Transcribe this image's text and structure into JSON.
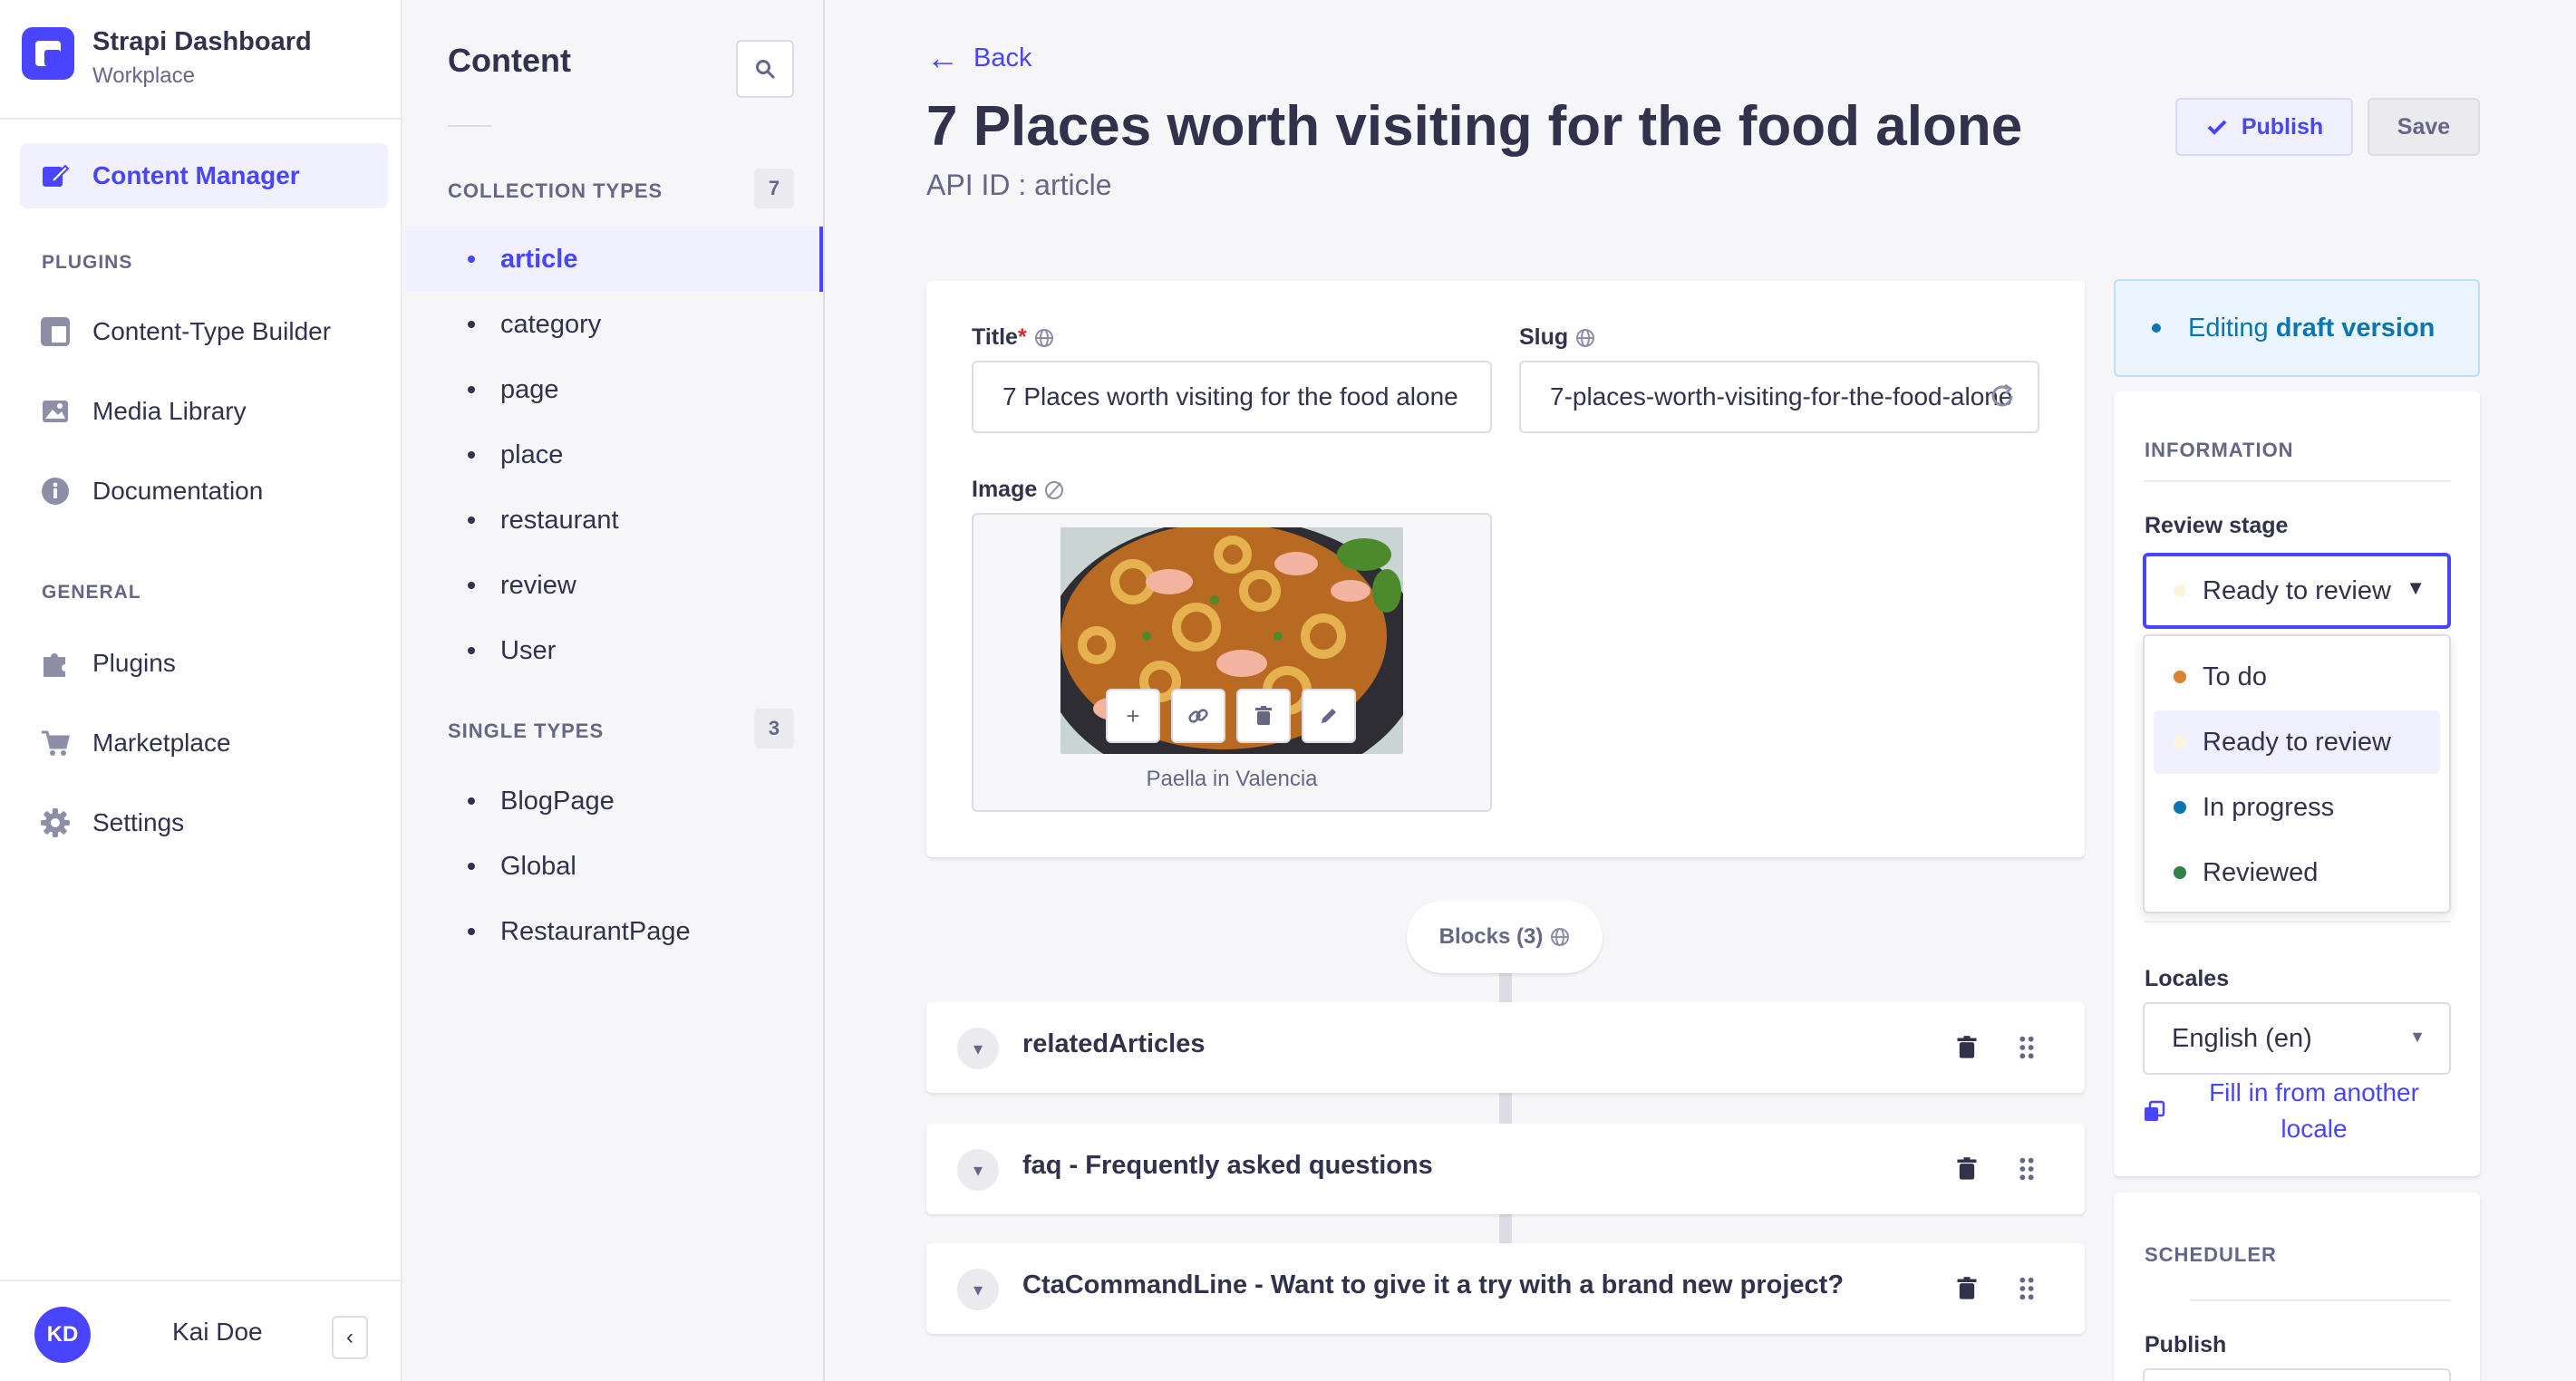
{
  "brand": {
    "title": "Strapi Dashboard",
    "subtitle": "Workplace"
  },
  "nav": {
    "active_item": "Content Manager",
    "plugins_label": "PLUGINS",
    "plugins": [
      "Content-Type Builder",
      "Media Library",
      "Documentation"
    ],
    "general_label": "GENERAL",
    "general": [
      "Plugins",
      "Marketplace",
      "Settings"
    ]
  },
  "user": {
    "initials": "KD",
    "name": "Kai Doe"
  },
  "content_nav": {
    "title": "Content",
    "collection_label": "COLLECTION TYPES",
    "collection_count": "7",
    "collection_types": [
      "article",
      "category",
      "page",
      "place",
      "restaurant",
      "review",
      "User"
    ],
    "single_label": "SINGLE TYPES",
    "single_count": "3",
    "single_types": [
      "BlogPage",
      "Global",
      "RestaurantPage"
    ]
  },
  "header": {
    "back_label": "Back",
    "title": "7 Places worth visiting for the food alone",
    "api_id": "API ID : article",
    "publish_label": "Publish",
    "save_label": "Save"
  },
  "form": {
    "title_label": "Title",
    "title_required": "*",
    "title_value": "7 Places worth visiting for the food alone",
    "slug_label": "Slug",
    "slug_value": "7-places-worth-visiting-for-the-food-alone",
    "image_label": "Image",
    "image_caption": "Paella in Valencia"
  },
  "blocks": {
    "pill_label": "Blocks (3)",
    "items": [
      "relatedArticles",
      "faq - Frequently asked questions",
      "CtaCommandLine - Want to give it a try with a brand new project?"
    ]
  },
  "panel": {
    "draft_prefix": "Editing ",
    "draft_strong": "draft version",
    "info_label": "INFORMATION",
    "review_stage_label": "Review stage",
    "review_stage_value": "Ready to review",
    "stages": [
      {
        "name": "To do",
        "color": "#d9822f"
      },
      {
        "name": "Ready to review",
        "color": "#fdf4dc"
      },
      {
        "name": "In progress",
        "color": "#0c75af"
      },
      {
        "name": "Reviewed",
        "color": "#328048"
      }
    ],
    "locales_label": "Locales",
    "locale_value": "English (en)",
    "fill_link": "Fill in from another locale",
    "scheduler_label": "SCHEDULER",
    "publish_label": "Publish"
  },
  "colors": {
    "primary": "#4945ff",
    "text": "#32324d",
    "muted": "#666687"
  }
}
